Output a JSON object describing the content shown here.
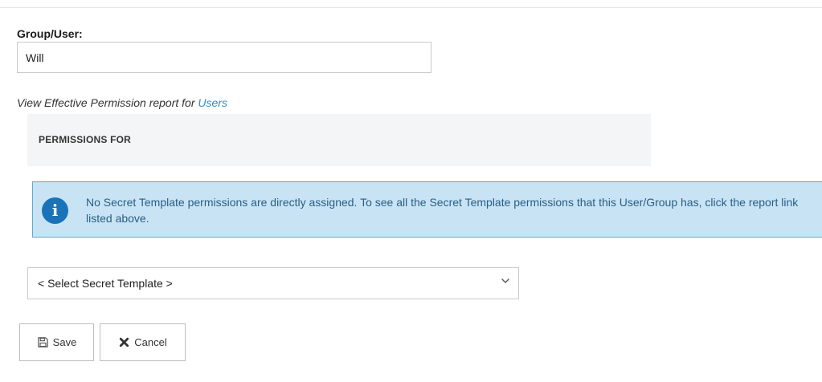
{
  "form": {
    "group_user_label": "Group/User:",
    "group_user_value": "Will"
  },
  "report": {
    "prefix": "View Effective Permission report for ",
    "link_label": "Users"
  },
  "permissions": {
    "heading": "PERMISSIONS FOR"
  },
  "info": {
    "icon": "info-icon",
    "message": "No Secret Template permissions are directly assigned. To see all the Secret Template permissions that this User/Group has, click the report link listed above."
  },
  "template_select": {
    "selected": "< Select Secret Template >",
    "icon": "chevron-down-icon"
  },
  "actions": {
    "save_label": "Save",
    "save_icon": "floppy-disk-icon",
    "cancel_label": "Cancel",
    "cancel_icon": "x-icon"
  },
  "colors": {
    "link": "#2d8ccb",
    "info_background": "#c8e4f4",
    "info_border": "#5fa8d3",
    "info_icon": "#1a73b8",
    "panel_background": "#f4f5f6"
  }
}
